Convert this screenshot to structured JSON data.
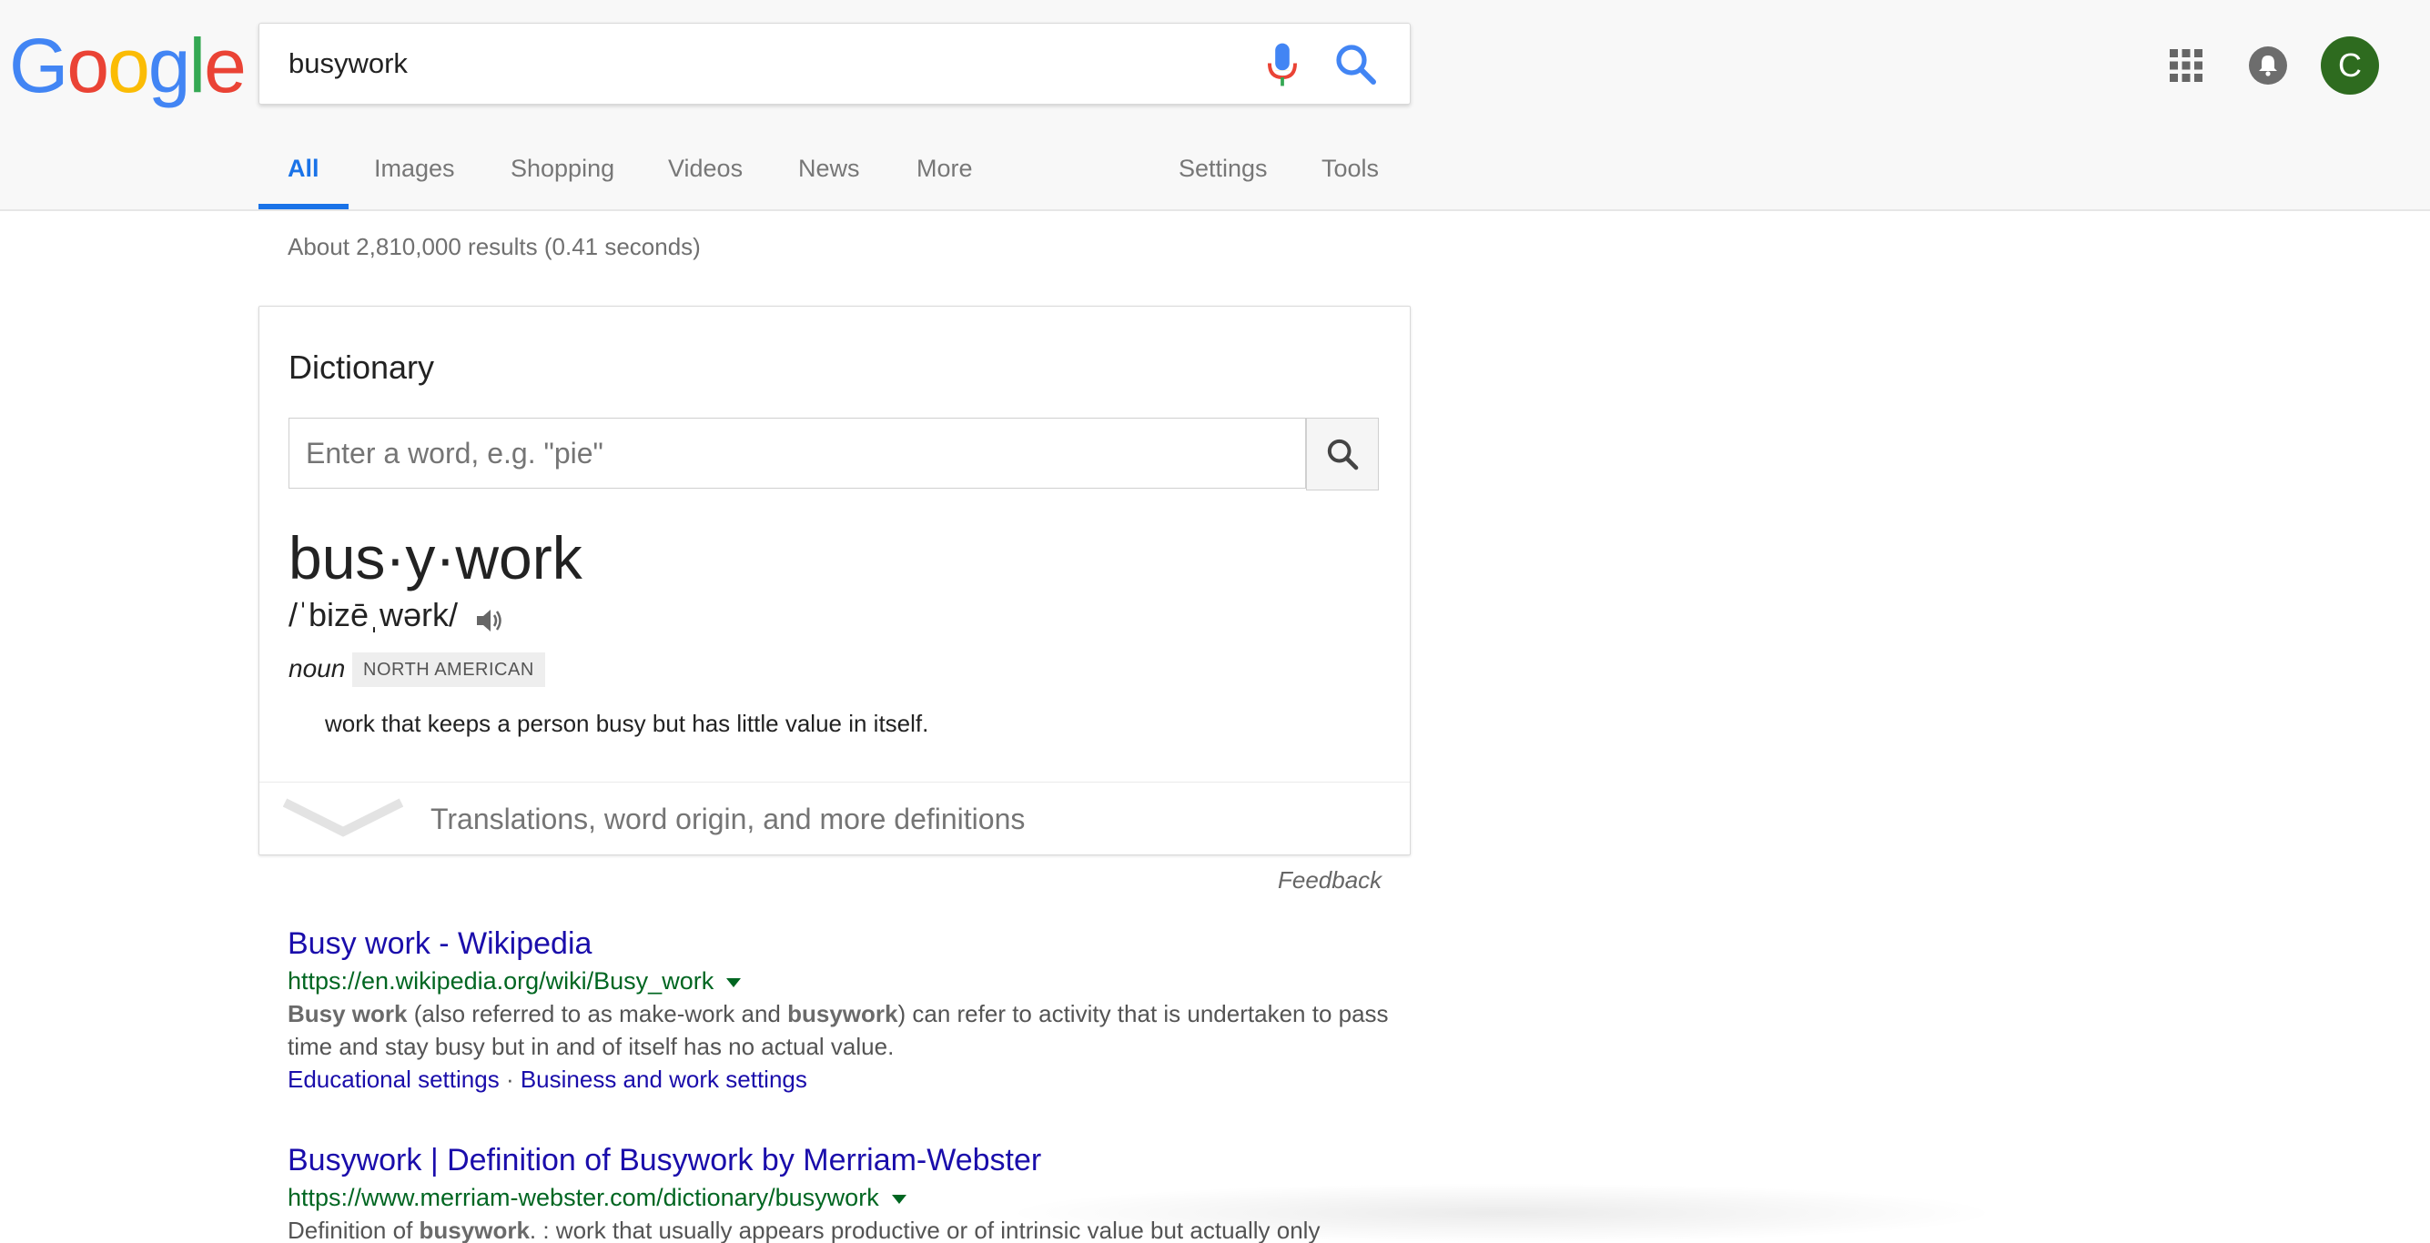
{
  "logo": {
    "letters": [
      "G",
      "o",
      "o",
      "g",
      "l",
      "e"
    ],
    "colors": [
      "#4285f4",
      "#ea4335",
      "#fbbc05",
      "#4285f4",
      "#34a853",
      "#ea4335"
    ]
  },
  "search": {
    "query": "busywork"
  },
  "header": {
    "avatar_letter": "C",
    "avatar_color": "#2e6b1f"
  },
  "tabs": [
    {
      "label": "All",
      "active": true
    },
    {
      "label": "Images"
    },
    {
      "label": "Shopping"
    },
    {
      "label": "Videos"
    },
    {
      "label": "News"
    },
    {
      "label": "More"
    },
    {
      "label": "Settings"
    },
    {
      "label": "Tools"
    }
  ],
  "result_stats": "About 2,810,000 results (0.41 seconds)",
  "dictionary": {
    "title": "Dictionary",
    "input_placeholder": "Enter a word, e.g. \"pie\"",
    "headword": "bus·y·work",
    "pronunciation": "/ˈbizēˌwərk/",
    "part_of_speech": "noun",
    "region": "NORTH AMERICAN",
    "definition": "work that keeps a person busy but has little value in itself.",
    "more_label": "Translations, word origin, and more definitions"
  },
  "feedback": "Feedback",
  "results": [
    {
      "title": "Busy work - Wikipedia",
      "url": "https://en.wikipedia.org/wiki/Busy_work",
      "snippet_parts": [
        {
          "text": "Busy work",
          "bold": true
        },
        {
          "text": " (also referred to as make-work and ",
          "bold": false
        },
        {
          "text": "busywork",
          "bold": true
        },
        {
          "text": ") can refer to activity that is undertaken to pass time and stay busy but in and of itself has no actual value.",
          "bold": false
        }
      ],
      "sitelinks": [
        "Educational settings",
        "Business and work settings"
      ]
    },
    {
      "title": "Busywork | Definition of Busywork by Merriam-Webster",
      "url": "https://www.merriam-webster.com/dictionary/busywork",
      "snippet_parts": [
        {
          "text": "Definition of ",
          "bold": false
        },
        {
          "text": "busywork",
          "bold": true
        },
        {
          "text": ". : work that usually appears productive or of intrinsic value but actually only",
          "bold": false
        }
      ]
    }
  ],
  "colors": {
    "link": "#1a0dab",
    "url": "#006621",
    "active_tab": "#1a73e8"
  }
}
